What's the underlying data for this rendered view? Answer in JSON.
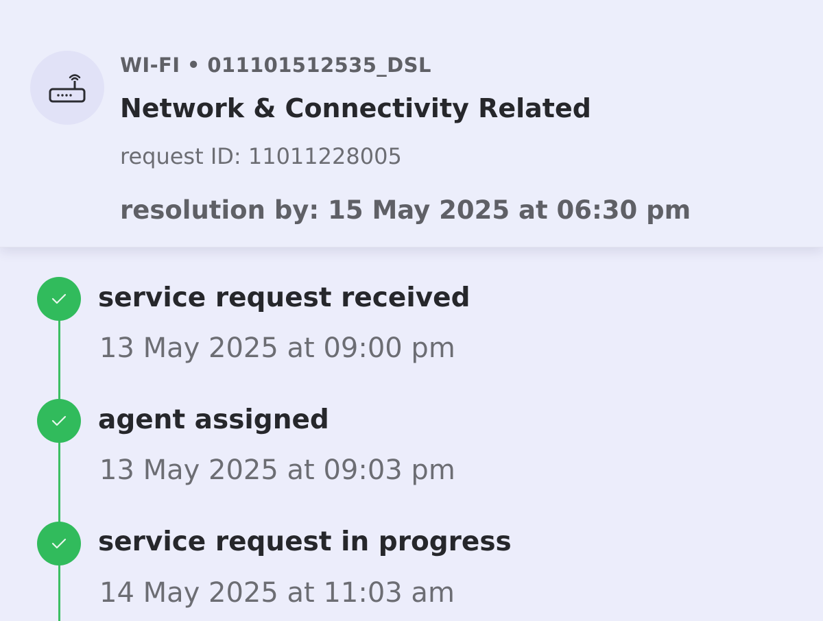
{
  "ticket": {
    "network": "WI-FI • 011101512535_DSL",
    "category": "Network & Connectivity Related",
    "request_id": "request ID: 11011228005",
    "resolution_by": "resolution by: 15 May 2025 at 06:30 pm",
    "icon": "router-icon"
  },
  "timeline": {
    "steps": [
      {
        "title": "service request received",
        "time": "13 May 2025 at 09:00 pm",
        "status": "completed",
        "icon": "check-icon"
      },
      {
        "title": "agent assigned",
        "time": "13 May 2025 at 09:03 pm",
        "status": "completed",
        "icon": "check-icon"
      },
      {
        "title": "service request in progress",
        "time": "14 May 2025 at 11:03 am",
        "status": "completed",
        "icon": "check-icon"
      }
    ]
  },
  "colors": {
    "background": "#ecedfb",
    "success": "#31bb5c",
    "text_primary": "#26272b",
    "text_secondary": "#6c6d73"
  }
}
